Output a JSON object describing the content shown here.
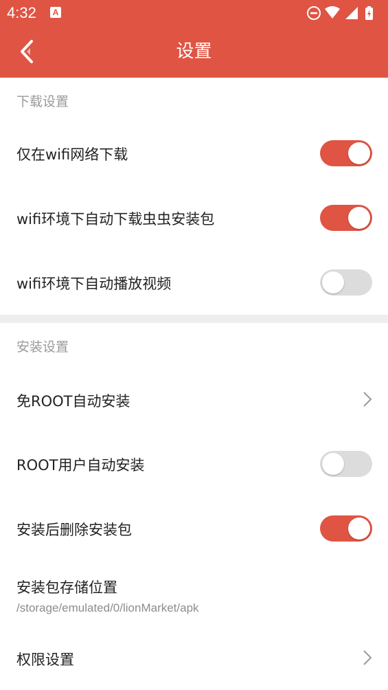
{
  "statusbar": {
    "time": "4:32",
    "app_icon_letter": "A",
    "icons": [
      "do-not-disturb-icon",
      "wifi-icon",
      "cell-signal-icon",
      "battery-icon"
    ]
  },
  "appbar": {
    "title": "设置",
    "back_icon": "back-chevron-icon"
  },
  "colors": {
    "accent": "#e05443",
    "toggle_off": "#dcdcdc",
    "section_text": "#9a9a9a",
    "divider": "#eeeeee"
  },
  "sections": [
    {
      "header": "下载设置",
      "items": [
        {
          "label": "仅在wifi网络下载",
          "control": "toggle",
          "state": "on"
        },
        {
          "label": "wifi环境下自动下载虫虫安装包",
          "control": "toggle",
          "state": "on"
        },
        {
          "label": "wifi环境下自动播放视频",
          "control": "toggle",
          "state": "off"
        }
      ]
    },
    {
      "header": "安装设置",
      "items": [
        {
          "label": "免ROOT自动安装",
          "control": "chevron"
        },
        {
          "label": "ROOT用户自动安装",
          "control": "toggle",
          "state": "off"
        },
        {
          "label": "安装后删除安装包",
          "control": "toggle",
          "state": "on"
        },
        {
          "label": "安装包存储位置",
          "control": "none",
          "subtitle": "/storage/emulated/0/lionMarket/apk"
        },
        {
          "label": "权限设置",
          "control": "chevron"
        }
      ]
    }
  ]
}
